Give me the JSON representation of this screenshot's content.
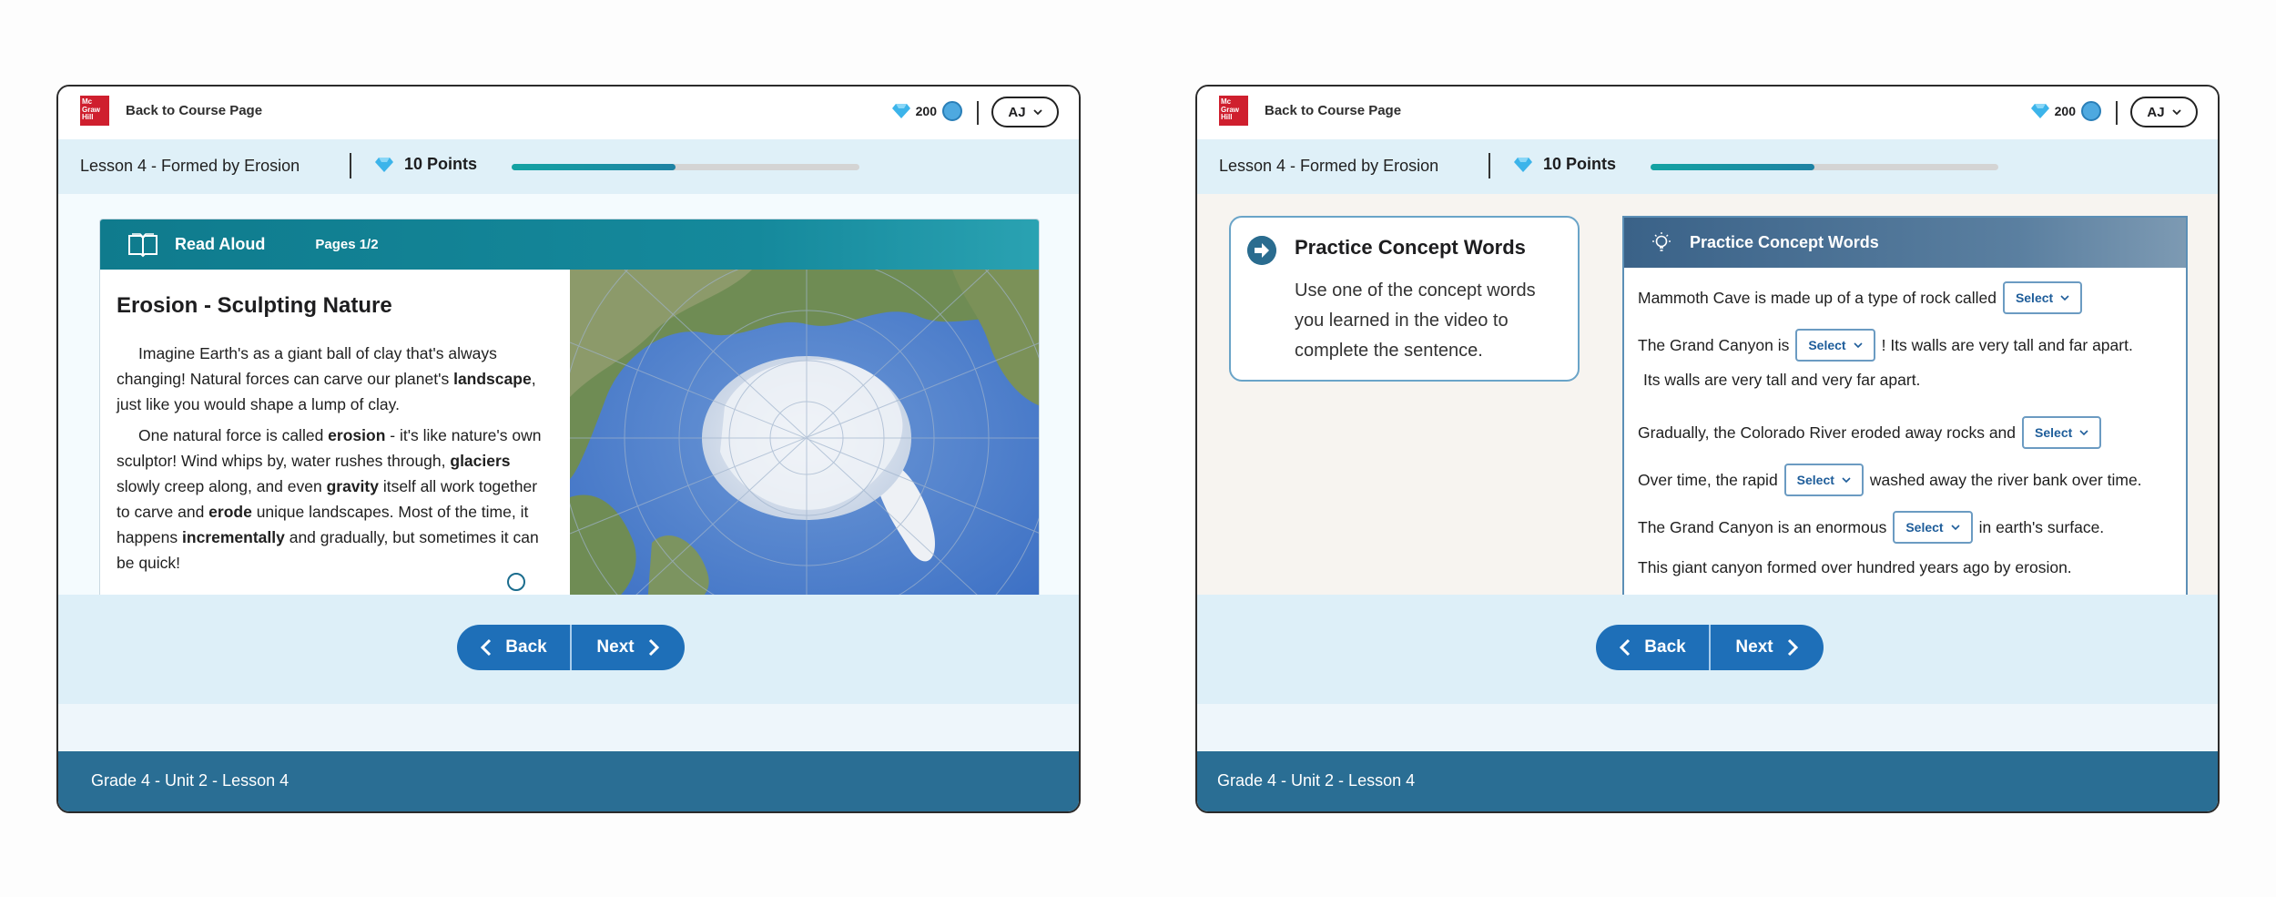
{
  "header": {
    "logo_lines": [
      "Mc",
      "Graw",
      "Hill"
    ],
    "back_link": "Back to Course Page",
    "gems": "200",
    "user_initials": "AJ"
  },
  "lesson": {
    "title": "Lesson 4 - Formed by Erosion",
    "points_label": "10 Points",
    "progress": 0.47
  },
  "reading": {
    "panel_title": "Read Aloud",
    "pages": "Pages 1/2",
    "title": "Erosion - Sculpting Nature",
    "p1_a": "Imagine Earth's as a giant ball of clay that's always changing! Natural forces can carve our planet's ",
    "p1_b": "landscape",
    "p1_c": ", just like you would shape a lump of clay.",
    "p2_a": "One natural force is called ",
    "p2_b": "erosion",
    "p2_c": " - it's like nature's own sculptor! Wind whips by, water rushes through, ",
    "p2_d": "glaciers",
    "p2_e": " slowly creep along, and even ",
    "p2_f": "gravity",
    "p2_g": " itself all work together to carve and ",
    "p2_h": "erode",
    "p2_i": " unique landscapes. Most of the time, it happens ",
    "p2_j": "incrementally",
    "p2_k": " and gradually, but sometimes it can be quick!"
  },
  "concept": {
    "title": "Practice Concept Words",
    "text": "Use one of the concept words you learned in the video to complete the sentence."
  },
  "practice": {
    "title": "Practice Concept Words",
    "select_label": "Select",
    "q1": "Mammoth Cave is made up of a type of rock called",
    "q2_a": "The Grand Canyon is",
    "q2_b": "! Its walls are very tall and far apart.",
    "q3": "Its walls are very tall and very far apart.",
    "q4": "Gradually, the Colorado River eroded away rocks and",
    "q5_a": "Over time, the rapid",
    "q5_b": "washed away the river bank over time.",
    "q6_a": "The Grand Canyon is an enormous",
    "q6_b": "in earth's surface.",
    "q7": "This giant canyon formed over hundred years ago by erosion."
  },
  "nav": {
    "back": "Back",
    "next": "Next"
  },
  "footer": "Grade 4 - Unit 2 - Lesson 4",
  "colors": {
    "brand_red": "#cf1f2e",
    "nav_blue": "#1e6fb8",
    "footer": "#2a6e94",
    "teal_header": "#15899c",
    "practice_header": "#4a7298"
  },
  "icons": [
    "gem-icon",
    "avatar-icon",
    "chevron-down-icon",
    "book-icon",
    "arrow-right-circle-icon",
    "lightbulb-icon",
    "chevron-left-icon",
    "chevron-right-icon"
  ]
}
